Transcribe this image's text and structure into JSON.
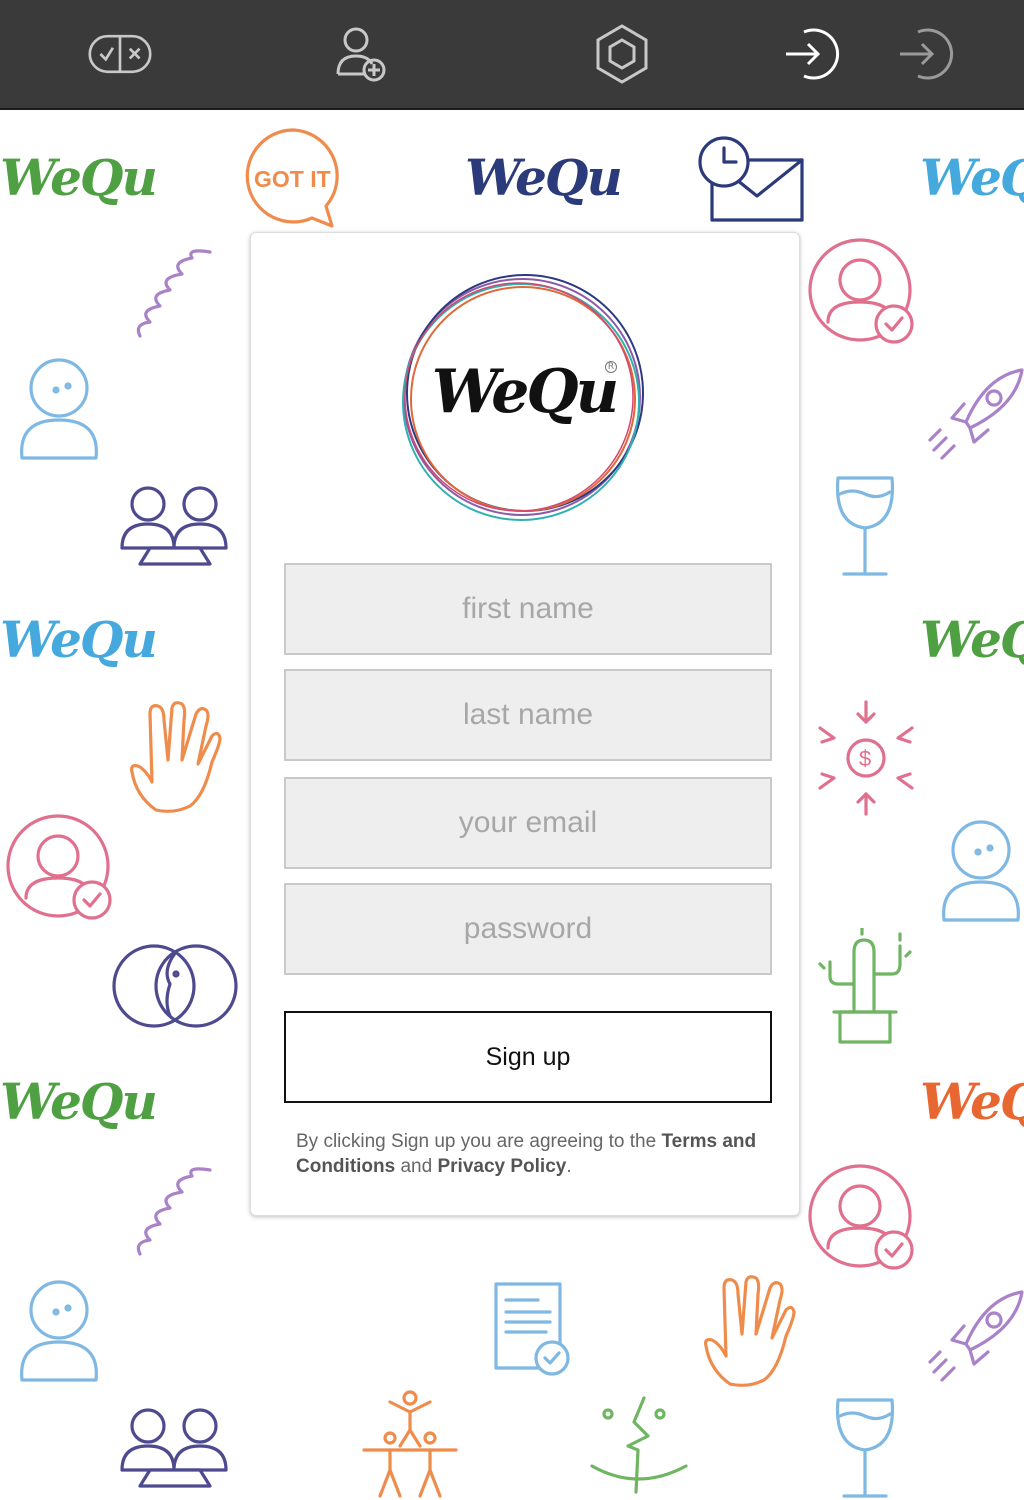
{
  "toolbar": {
    "buttons": [
      {
        "name": "checkbox-toggle-icon"
      },
      {
        "name": "add-user-icon"
      },
      {
        "name": "hexagon-icon"
      },
      {
        "name": "sign-in-arrow-icon-active"
      },
      {
        "name": "sign-in-arrow-icon-inactive"
      }
    ],
    "colors": {
      "background": "#3a3a3a",
      "icon": "#c8c8c8",
      "active_icon": "#ffffff"
    }
  },
  "background": {
    "logo_text": "WeQu",
    "badge_text": "GOT IT",
    "colors": {
      "green": "#4fa043",
      "navy": "#2b3a7a",
      "blue": "#45a9dd",
      "orange": "#ef8c4c",
      "pink": "#e0708e",
      "purple": "#a982c9",
      "indigo": "#4d4a8f",
      "light_blue": "#7fb8e2",
      "red_orange": "#e8662f"
    }
  },
  "card": {
    "logo_text": "WeQu",
    "logo_registered": "R",
    "form": {
      "first_name_placeholder": "first name",
      "last_name_placeholder": "last name",
      "email_placeholder": "your email",
      "password_placeholder": "password",
      "signup_label": "Sign up"
    },
    "terms": {
      "prefix": "By clicking Sign up you are agreeing to the ",
      "terms_link": "Terms and Conditions",
      "middle": " and ",
      "privacy_link": "Privacy Policy",
      "suffix": "."
    }
  }
}
